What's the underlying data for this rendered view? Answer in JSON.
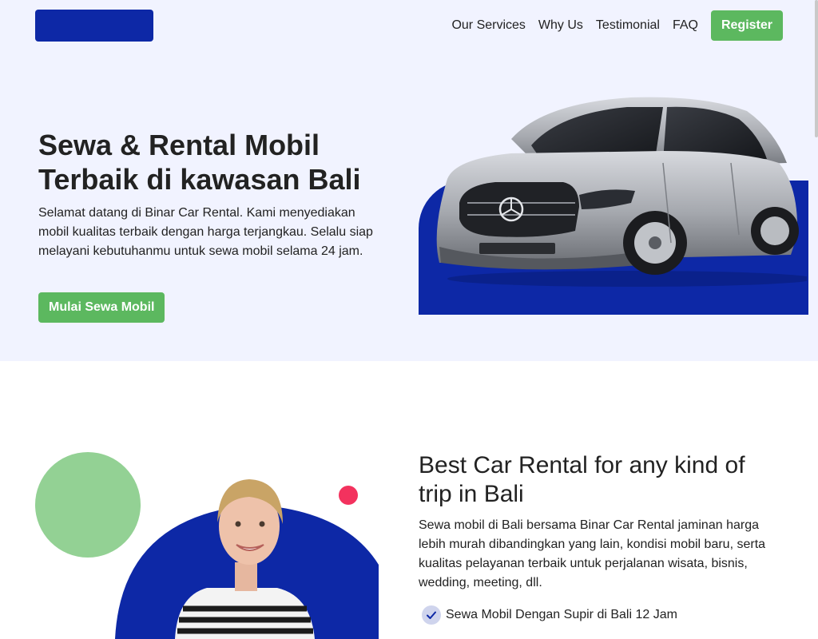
{
  "nav": {
    "links": [
      "Our Services",
      "Why Us",
      "Testimonial",
      "FAQ"
    ],
    "register_label": "Register"
  },
  "hero": {
    "title": "Sewa & Rental Mobil Terbaik di kawasan Bali",
    "description": "Selamat datang di Binar Car Rental. Kami menyediakan mobil kualitas terbaik dengan harga terjangkau. Selalu siap melayani kebutuhanmu untuk sewa mobil selama 24 jam.",
    "cta_label": "Mulai Sewa Mobil"
  },
  "why": {
    "title": "Best Car Rental for any kind of trip in Bali",
    "description": "Sewa mobil di Bali bersama Binar Car Rental jaminan harga lebih murah dibandingkan yang lain, kondisi mobil baru, serta kualitas pelayanan terbaik untuk perjalanan wisata, bisnis, wedding, meeting, dll.",
    "checklist": [
      "Sewa Mobil Dengan Supir di Bali 12 Jam"
    ]
  },
  "colors": {
    "primary_blue": "#0d28a6",
    "green": "#5cb85f",
    "light_bg": "#f1f3ff",
    "light_green": "#93d194",
    "red_dot": "#f3325e"
  },
  "icons": {
    "check": "check-icon",
    "logo": "brand-logo"
  }
}
